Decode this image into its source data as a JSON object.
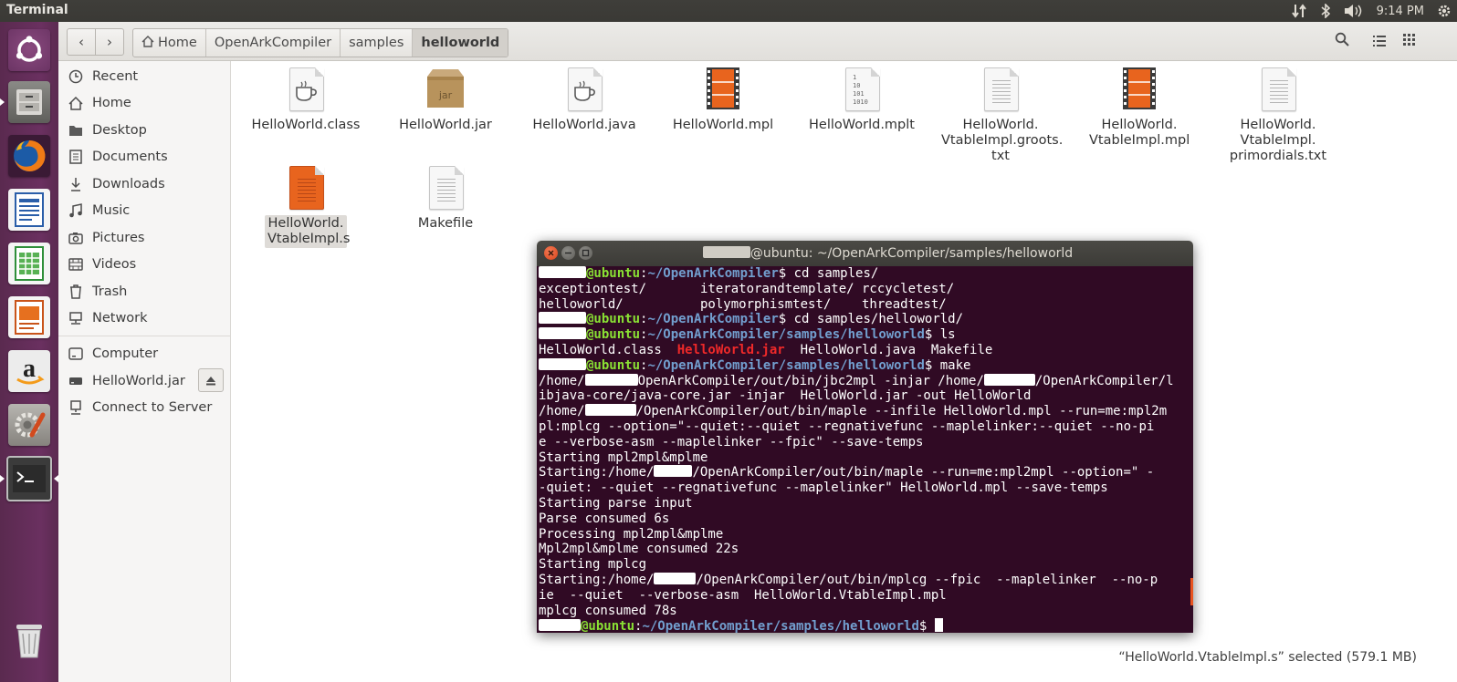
{
  "top_panel": {
    "app_title": "Terminal",
    "clock": "9:14 PM"
  },
  "launcher": {
    "items": [
      "ubuntu-dash",
      "files",
      "firefox",
      "libreoffice-writer",
      "libreoffice-calc",
      "libreoffice-impress",
      "amazon",
      "system-settings",
      "terminal",
      "trash"
    ]
  },
  "header": {
    "breadcrumbs": [
      "Home",
      "OpenArkCompiler",
      "samples",
      "helloworld"
    ]
  },
  "sidebar": {
    "items": [
      {
        "label": "Recent",
        "icon": "clock-icon"
      },
      {
        "label": "Home",
        "icon": "home-icon"
      },
      {
        "label": "Desktop",
        "icon": "folder-icon"
      },
      {
        "label": "Documents",
        "icon": "documents-icon"
      },
      {
        "label": "Downloads",
        "icon": "download-icon"
      },
      {
        "label": "Music",
        "icon": "music-icon"
      },
      {
        "label": "Pictures",
        "icon": "camera-icon"
      },
      {
        "label": "Videos",
        "icon": "film-icon"
      },
      {
        "label": "Trash",
        "icon": "trash-icon"
      },
      {
        "label": "Network",
        "icon": "network-icon"
      },
      {
        "label": "Computer",
        "icon": "computer-icon"
      },
      {
        "label": "HelloWorld.jar",
        "icon": "drive-icon"
      },
      {
        "label": "Connect to Server",
        "icon": "server-icon"
      }
    ]
  },
  "files": [
    {
      "name": "HelloWorld.class",
      "type": "java"
    },
    {
      "name": "HelloWorld.jar",
      "type": "jar"
    },
    {
      "name": "HelloWorld.java",
      "type": "java"
    },
    {
      "name": "HelloWorld.mpl",
      "type": "media"
    },
    {
      "name": "HelloWorld.mplt",
      "type": "binary"
    },
    {
      "name": "HelloWorld. VtableImpl.groots. txt",
      "type": "text"
    },
    {
      "name": "HelloWorld. VtableImpl.mpl",
      "type": "media"
    },
    {
      "name": "HelloWorld. VtableImpl. primordials.txt",
      "type": "text"
    },
    {
      "name": "HelloWorld. VtableImpl.s",
      "type": "asm",
      "selected": true
    },
    {
      "name": "Makefile",
      "type": "text"
    }
  ],
  "status": "“HelloWorld.VtableImpl.s” selected  (579.1 MB)",
  "terminal": {
    "title": "@ubuntu: ~/OpenArkCompiler/samples/helloworld",
    "lines": [
      [
        {
          "r": 52
        },
        {
          "c": "g",
          "t": "@ubuntu"
        },
        {
          "c": "w",
          "t": ":"
        },
        {
          "c": "b",
          "t": "~/OpenArkCompiler"
        },
        {
          "c": "w",
          "t": "$ cd samples/"
        }
      ],
      [
        {
          "c": "w",
          "t": "exceptiontest/       iteratorandtemplate/ rccycletest/"
        }
      ],
      [
        {
          "c": "w",
          "t": "helloworld/          polymorphismtest/    threadtest/"
        }
      ],
      [
        {
          "r": 52
        },
        {
          "c": "g",
          "t": "@ubuntu"
        },
        {
          "c": "w",
          "t": ":"
        },
        {
          "c": "b",
          "t": "~/OpenArkCompiler"
        },
        {
          "c": "w",
          "t": "$ cd samples/helloworld/"
        }
      ],
      [
        {
          "r": 52
        },
        {
          "c": "g",
          "t": "@ubuntu"
        },
        {
          "c": "w",
          "t": ":"
        },
        {
          "c": "b",
          "t": "~/OpenArkCompiler/samples/helloworld"
        },
        {
          "c": "w",
          "t": "$ ls"
        }
      ],
      [
        {
          "c": "w",
          "t": "HelloWorld.class  "
        },
        {
          "c": "r",
          "t": "HelloWorld.jar"
        },
        {
          "c": "w",
          "t": "  HelloWorld.java  Makefile"
        }
      ],
      [
        {
          "r": 52
        },
        {
          "c": "g",
          "t": "@ubuntu"
        },
        {
          "c": "w",
          "t": ":"
        },
        {
          "c": "b",
          "t": "~/OpenArkCompiler/samples/helloworld"
        },
        {
          "c": "w",
          "t": "$ make"
        }
      ],
      [
        {
          "c": "w",
          "t": "/home/"
        },
        {
          "r": 58
        },
        {
          "c": "w",
          "t": "OpenArkCompiler/out/bin/jbc2mpl -injar /home/"
        },
        {
          "r": 56
        },
        {
          "c": "w",
          "t": "/OpenArkCompiler/l"
        }
      ],
      [
        {
          "c": "w",
          "t": "ibjava-core/java-core.jar -injar  HelloWorld.jar -out HelloWorld"
        }
      ],
      [
        {
          "c": "w",
          "t": "/home/"
        },
        {
          "r": 56
        },
        {
          "c": "w",
          "t": "/OpenArkCompiler/out/bin/maple --infile HelloWorld.mpl --run=me:mpl2m"
        }
      ],
      [
        {
          "c": "w",
          "t": "pl:mplcg --option=\"--quiet:--quiet --regnativefunc --maplelinker:--quiet --no-pi"
        }
      ],
      [
        {
          "c": "w",
          "t": "e --verbose-asm --maplelinker --fpic\" --save-temps"
        }
      ],
      [
        {
          "c": "w",
          "t": "Starting mpl2mpl&mplme"
        }
      ],
      [
        {
          "c": "w",
          "t": "Starting:/home/"
        },
        {
          "r": 42
        },
        {
          "c": "w",
          "t": "/OpenArkCompiler/out/bin/maple --run=me:mpl2mpl --option=\" -"
        }
      ],
      [
        {
          "c": "w",
          "t": "-quiet: --quiet --regnativefunc --maplelinker\" HelloWorld.mpl --save-temps"
        }
      ],
      [
        {
          "c": "w",
          "t": "Starting parse input"
        }
      ],
      [
        {
          "c": "w",
          "t": "Parse consumed 6s"
        }
      ],
      [
        {
          "c": "w",
          "t": "Processing mpl2mpl&mplme"
        }
      ],
      [
        {
          "c": "w",
          "t": "Mpl2mpl&mplme consumed 22s"
        }
      ],
      [
        {
          "c": "w",
          "t": "Starting mplcg"
        }
      ],
      [
        {
          "c": "w",
          "t": "Starting:/home/"
        },
        {
          "r": 46
        },
        {
          "c": "w",
          "t": "/OpenArkCompiler/out/bin/mplcg --fpic  --maplelinker  --no-p"
        }
      ],
      [
        {
          "c": "w",
          "t": "ie  --quiet  --verbose-asm  HelloWorld.VtableImpl.mpl"
        }
      ],
      [
        {
          "c": "w",
          "t": "mplcg consumed 78s"
        }
      ],
      [
        {
          "r": 46
        },
        {
          "c": "g",
          "t": "@ubuntu"
        },
        {
          "c": "w",
          "t": ":"
        },
        {
          "c": "b",
          "t": "~/OpenArkCompiler/samples/helloworld"
        },
        {
          "c": "w",
          "t": "$ "
        },
        {
          "cursor": true
        }
      ]
    ]
  }
}
